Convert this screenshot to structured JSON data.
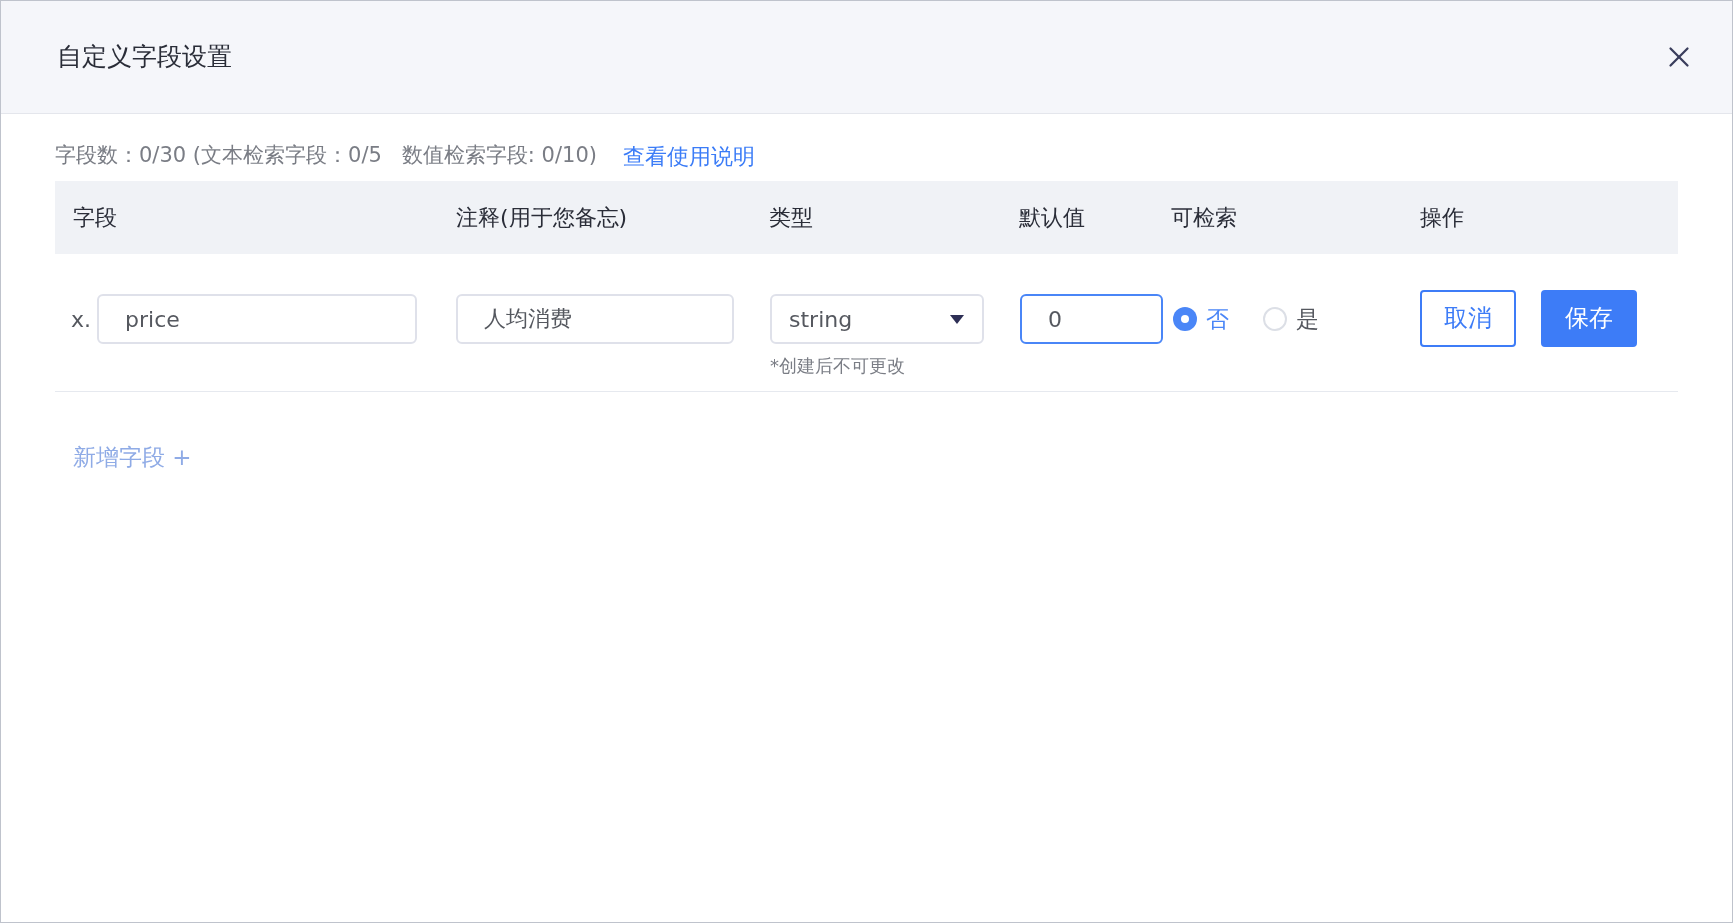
{
  "dialog": {
    "title": "自定义字段设置"
  },
  "summary": {
    "text": "字段数：0/30 (文本检索字段：0/5   数值检索字段: 0/10)",
    "link": "查看使用说明"
  },
  "table": {
    "columns": [
      "字段",
      "注释(用于您备忘)",
      "类型",
      "默认值",
      "可检索",
      "操作"
    ],
    "rows": [
      {
        "prefix": "x.",
        "name": "price",
        "note": "人均消费",
        "type": "string",
        "type_hint": "*创建后不可更改",
        "default": {
          "value": "0",
          "focused": true
        },
        "searchable": [
          {
            "label": "否",
            "selected": true
          },
          {
            "label": "是",
            "selected": false
          }
        ],
        "actions": [
          {
            "label": "取消",
            "kind": "outline"
          },
          {
            "label": "保存",
            "kind": "primary"
          }
        ]
      }
    ]
  },
  "add_field": {
    "label": "新增字段 +",
    "disabled": true
  }
}
